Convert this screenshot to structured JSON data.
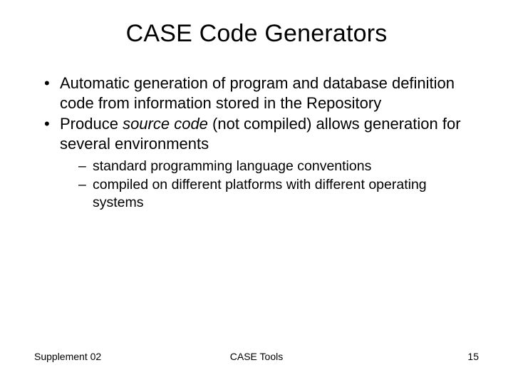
{
  "title": "CASE Code Generators",
  "bullets": [
    {
      "text": "Automatic generation of program and database definition code from information stored in the Repository"
    },
    {
      "pre": "Produce ",
      "em": "source code",
      "post": " (not compiled) allows generation for several environments",
      "sub": [
        "standard programming language conventions",
        "compiled on different platforms with different operating systems"
      ]
    }
  ],
  "footer": {
    "left": "Supplement 02",
    "center": "CASE Tools",
    "right": "15"
  }
}
